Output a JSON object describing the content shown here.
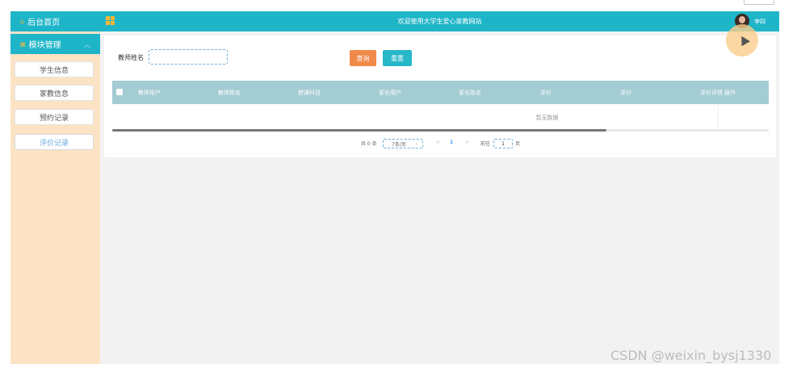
{
  "sidebar": {
    "home_label": "后台首页",
    "group_label": "模块管理",
    "items": [
      {
        "label": "学生信息"
      },
      {
        "label": "家教信息"
      },
      {
        "label": "预约记录"
      },
      {
        "label": "评价记录",
        "active": true
      }
    ]
  },
  "header": {
    "welcome": "欢迎使用大学生爱心家教网站",
    "username": "李四"
  },
  "search": {
    "label": "教师姓名",
    "value": "",
    "query_button": "查询",
    "reset_button": "重置"
  },
  "table": {
    "columns": [
      "教师用户",
      "教师姓名",
      "授课科目",
      "家长用户",
      "家长姓名",
      "评价",
      "评分",
      "评价详情",
      "操作"
    ],
    "rows": [],
    "empty_text": "暂无数据"
  },
  "pagination": {
    "total": "共 0 条",
    "page_size": "7条/页",
    "prev": "<",
    "current_page": "1",
    "next": ">",
    "goto_label": "前往",
    "goto_value": "1",
    "page_suffix": "页"
  },
  "watermark": "CSDN @weixin_bysj1330",
  "colors": {
    "header": "#1fb5c8",
    "sidebar": "#fbe3c4",
    "query_button": "#f08a4b",
    "reset_button": "#26b7c8",
    "table_header": "#a4ccd3"
  }
}
